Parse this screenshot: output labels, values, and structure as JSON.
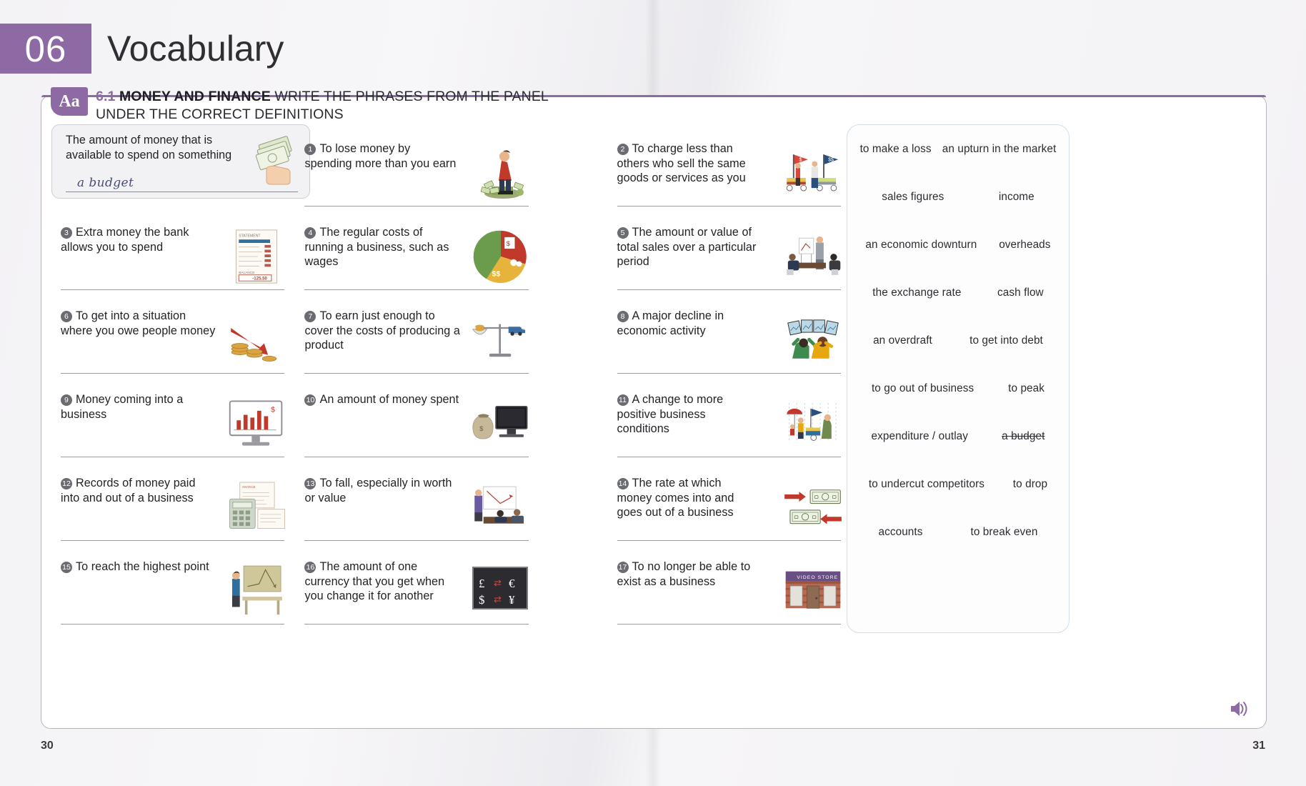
{
  "chapter": {
    "number": "06",
    "title": "Vocabulary"
  },
  "exercise": {
    "badge": "Aa",
    "number": "6.1",
    "topic": "MONEY AND FINANCE",
    "instruction_rest": " WRITE THE PHRASES FROM THE PANEL",
    "instruction_line2": "UNDER THE CORRECT DEFINITIONS"
  },
  "example": {
    "definition": "The amount of money that is available to spend on something",
    "answer": "a budget",
    "art": "hand-holding-cash"
  },
  "items": [
    {
      "n": "1",
      "definition": "To lose money by spending more than you earn",
      "art": "man-falling-money"
    },
    {
      "n": "2",
      "definition": "To charge less than others who sell the same goods or services as you",
      "art": "two-market-stalls"
    },
    {
      "n": "3",
      "definition": "Extra money the bank allows you to spend",
      "art": "bank-statement"
    },
    {
      "n": "4",
      "definition": "The regular costs of running a business, such as wages",
      "art": "pie-chart-costs"
    },
    {
      "n": "5",
      "definition": "The amount or value of total sales over a particular period",
      "art": "meeting-presentation"
    },
    {
      "n": "6",
      "definition": "To get into a situation where you owe people money",
      "art": "falling-coins-arrow"
    },
    {
      "n": "7",
      "definition": "To earn just enough to cover the costs of producing a product",
      "art": "balance-scales"
    },
    {
      "n": "8",
      "definition": "A major decline in economic activity",
      "art": "traders-panic-screens"
    },
    {
      "n": "9",
      "definition": "Money coming into a business",
      "art": "monitor-bar-chart"
    },
    {
      "n": "10",
      "definition": "An amount of money spent",
      "art": "money-bag-monitor"
    },
    {
      "n": "11",
      "definition": "A change to more positive business conditions",
      "art": "rainy-street-stall"
    },
    {
      "n": "12",
      "definition": "Records of money paid into and out of a business",
      "art": "invoice-calculator"
    },
    {
      "n": "13",
      "definition": "To fall, especially in worth or value",
      "art": "presentation-decline"
    },
    {
      "n": "14",
      "definition": "The rate at which money comes into and goes out of a business",
      "art": "banknotes-arrows"
    },
    {
      "n": "15",
      "definition": "To reach the highest point",
      "art": "peak-graph-board"
    },
    {
      "n": "16",
      "definition": "The amount of one currency that you get when you change it for another",
      "art": "currency-symbols-board"
    },
    {
      "n": "17",
      "definition": "To no longer be able to exist as a business",
      "art": "closed-video-store"
    }
  ],
  "wordbank": {
    "rows": [
      [
        {
          "text": "to make a loss",
          "used": false
        },
        {
          "text": "an upturn in the market",
          "used": false
        }
      ],
      [
        {
          "text": "sales figures",
          "used": false
        },
        {
          "text": "income",
          "used": false
        }
      ],
      [
        {
          "text": "an economic downturn",
          "used": false
        },
        {
          "text": "overheads",
          "used": false
        }
      ],
      [
        {
          "text": "the exchange rate",
          "used": false
        },
        {
          "text": "cash flow",
          "used": false
        }
      ],
      [
        {
          "text": "an overdraft",
          "used": false
        },
        {
          "text": "to get into debt",
          "used": false
        }
      ],
      [
        {
          "text": "to go out of business",
          "used": false
        },
        {
          "text": "to peak",
          "used": false
        }
      ],
      [
        {
          "text": "expenditure / outlay",
          "used": false
        },
        {
          "text": "a budget",
          "used": true
        }
      ],
      [
        {
          "text": "to undercut competitors",
          "used": false
        },
        {
          "text": "to drop",
          "used": false
        }
      ],
      [
        {
          "text": "accounts",
          "used": false
        },
        {
          "text": "to break even",
          "used": false
        }
      ]
    ]
  },
  "statement_art": {
    "title": "STATEMENT",
    "balance_label": "BALANCE",
    "balance_value": "-125.50"
  },
  "video_store_art": {
    "sign": "VIDEO STORE"
  },
  "currency_art": {
    "symbols": [
      "£",
      "€",
      "$",
      "¥"
    ]
  },
  "audio": {
    "icon": "speaker-icon"
  },
  "pages": {
    "left": "30",
    "right": "31"
  },
  "colors": {
    "accent_purple": "#8e6aa5",
    "card_border": "#b9b2c0",
    "wordbank_border": "#cfe0ea",
    "handwriting": "#4a4e78"
  }
}
